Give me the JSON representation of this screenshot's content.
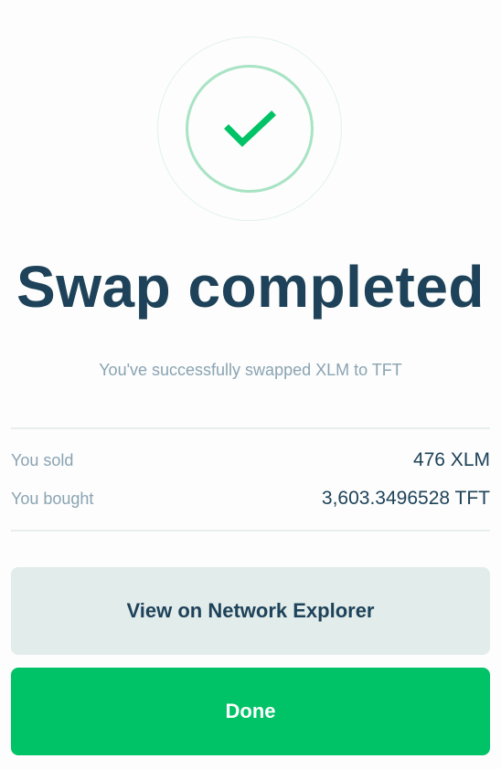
{
  "success_icon": {
    "icon": "checkmark-icon",
    "accent_color": "#00c266"
  },
  "title": "Swap completed",
  "subtitle": "You've successfully swapped XLM to TFT",
  "summary": {
    "sold_label": "You sold",
    "sold_value": "476 XLM",
    "bought_label": "You bought",
    "bought_value": "3,603.3496528 TFT"
  },
  "actions": {
    "explorer_label": "View on Network Explorer",
    "done_label": "Done"
  },
  "colors": {
    "primary": "#00c266",
    "heading": "#1e4259",
    "muted": "#8aa3b3",
    "secondary_button": "#e2eceb"
  }
}
